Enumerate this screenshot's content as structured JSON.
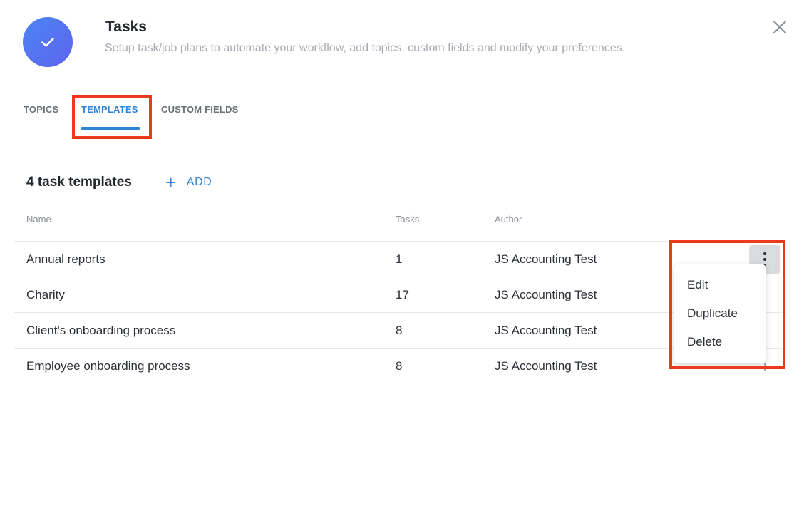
{
  "header": {
    "title": "Tasks",
    "subtitle": "Setup task/job plans to automate your workflow, add topics, custom fields and modify your preferences.",
    "icon": "check-icon",
    "close_icon": "close-icon"
  },
  "tabs": [
    {
      "label": "TOPICS",
      "active": false
    },
    {
      "label": "TEMPLATES",
      "active": true
    },
    {
      "label": "CUSTOM FIELDS",
      "active": false
    }
  ],
  "section": {
    "count_label": "4 task templates",
    "add_label": "ADD",
    "add_icon": "plus-icon"
  },
  "table": {
    "columns": [
      "Name",
      "Tasks",
      "Author"
    ],
    "rows": [
      {
        "name": "Annual reports",
        "tasks": "1",
        "author": "JS Accounting Test"
      },
      {
        "name": "Charity",
        "tasks": "17",
        "author": "JS Accounting Test"
      },
      {
        "name": "Client's onboarding process",
        "tasks": "8",
        "author": "JS Accounting Test"
      },
      {
        "name": "Employee onboarding process",
        "tasks": "8",
        "author": "JS Accounting Test"
      }
    ]
  },
  "row_menu": {
    "items": [
      "Edit",
      "Duplicate",
      "Delete"
    ],
    "icon": "kebab-menu-icon"
  },
  "colors": {
    "accent": "#2f84d6",
    "highlight": "#ee3a1c",
    "avatar_start": "#4a86f2",
    "avatar_end": "#5f63f0"
  }
}
